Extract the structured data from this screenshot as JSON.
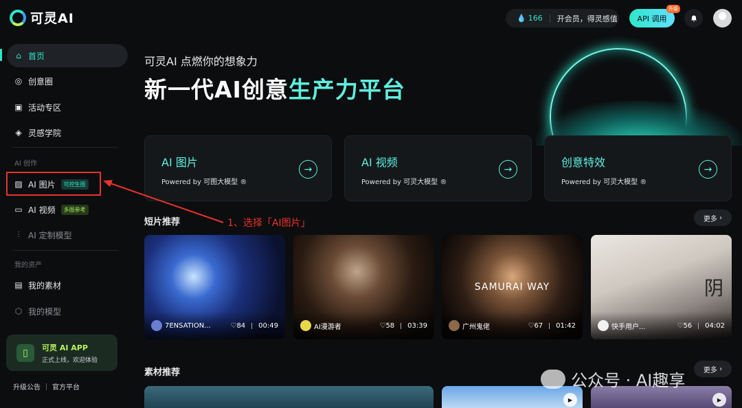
{
  "header": {
    "logo_text": "可灵AI",
    "points": "166",
    "vip_label": "开会员，得灵感值",
    "api_label": "API 调用",
    "api_badge": "升级"
  },
  "sidebar": {
    "items": [
      {
        "label": "首页"
      },
      {
        "label": "创意圈"
      },
      {
        "label": "活动专区"
      },
      {
        "label": "灵感学院"
      }
    ],
    "section_create": "AI 创作",
    "create_items": [
      {
        "label": "AI 图片",
        "tag": "可控生图"
      },
      {
        "label": "AI 视频",
        "tag": "多图参考"
      },
      {
        "label": "AI 定制模型"
      }
    ],
    "section_assets": "我的资产",
    "asset_items": [
      {
        "label": "我的素材"
      },
      {
        "label": "我的模型"
      }
    ],
    "app_card": {
      "title": "可灵 AI APP",
      "subtitle": "正式上线，欢迎体验"
    },
    "footer": {
      "announce": "升级公告",
      "official": "官方平台"
    }
  },
  "hero": {
    "subtitle": "可灵AI 点燃你的想象力",
    "title_part1": "新一代AI创意",
    "title_part2": "生产力平台"
  },
  "features": [
    {
      "title": "AI 图片",
      "powered": "Powered by 可图大模型 ®"
    },
    {
      "title": "AI 视频",
      "powered": "Powered by 可灵大模型 ®"
    },
    {
      "title": "创意特效",
      "powered": "Powered by 可灵大模型 ®"
    }
  ],
  "annotation": "1、选择「AI图片」",
  "shorts": {
    "title": "短片推荐",
    "more": "更多",
    "cards": [
      {
        "user": "7ENSATION...",
        "likes": "84",
        "duration": "00:49"
      },
      {
        "user": "AI漫游者",
        "likes": "58",
        "duration": "03:39"
      },
      {
        "user": "广州鬼佬",
        "likes": "67",
        "duration": "01:42",
        "overlay_text": "SAMURAI WAY"
      },
      {
        "user": "快手用户...",
        "likes": "56",
        "duration": "04:02",
        "overlay_text": "阴"
      }
    ]
  },
  "materials": {
    "title": "素材推荐",
    "more": "更多"
  },
  "watermark": "公众号 · AI趣享"
}
